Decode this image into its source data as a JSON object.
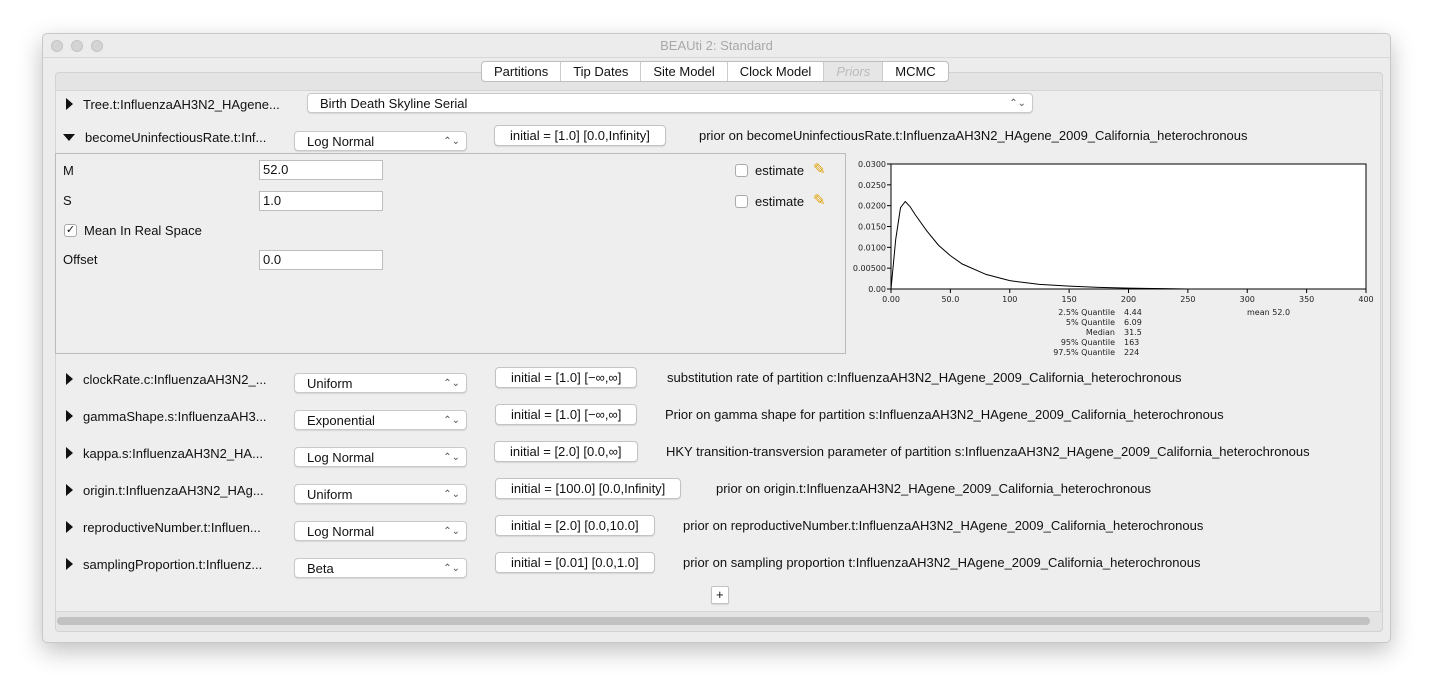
{
  "window": {
    "title": "BEAUti 2: Standard"
  },
  "tabs": [
    {
      "label": "Partitions"
    },
    {
      "label": "Tip Dates"
    },
    {
      "label": "Site Model"
    },
    {
      "label": "Clock Model"
    },
    {
      "label": "Priors",
      "disabled": true
    },
    {
      "label": "MCMC"
    }
  ],
  "tree": {
    "label": "Tree.t:InfluenzaAH3N2_HAgene...",
    "prior": "Birth Death Skyline Serial"
  },
  "expanded": {
    "label": "becomeUninfectiousRate.t:Inf...",
    "dist": "Log Normal",
    "initial": "initial = [1.0] [0.0,Infinity]",
    "desc": "prior on becomeUninfectiousRate.t:InfluenzaAH3N2_HAgene_2009_California_heterochronous",
    "params": {
      "m_label": "M",
      "m_value": "52.0",
      "s_label": "S",
      "s_value": "1.0",
      "mean_real_label": "Mean In Real Space",
      "mean_real_checked": true,
      "offset_label": "Offset",
      "offset_value": "0.0",
      "estimate_label": "estimate"
    }
  },
  "priors": [
    {
      "label": "clockRate.c:InfluenzaAH3N2_...",
      "dist": "Uniform",
      "initial": "initial = [1.0] [−∞,∞]",
      "desc": "substitution rate of partition c:InfluenzaAH3N2_HAgene_2009_California_heterochronous"
    },
    {
      "label": "gammaShape.s:InfluenzaAH3...",
      "dist": "Exponential",
      "initial": "initial = [1.0] [−∞,∞]",
      "desc": "Prior on gamma shape for partition s:InfluenzaAH3N2_HAgene_2009_California_heterochronous"
    },
    {
      "label": "kappa.s:InfluenzaAH3N2_HA...",
      "dist": "Log Normal",
      "initial": "initial = [2.0] [0.0,∞]",
      "desc": "HKY transition-transversion parameter of partition s:InfluenzaAH3N2_HAgene_2009_California_heterochronous"
    },
    {
      "label": "origin.t:InfluenzaAH3N2_HAg...",
      "dist": "Uniform",
      "initial": "initial = [100.0] [0.0,Infinity]",
      "desc": "prior on origin.t:InfluenzaAH3N2_HAgene_2009_California_heterochronous"
    },
    {
      "label": "reproductiveNumber.t:Influen...",
      "dist": "Log Normal",
      "initial": "initial = [2.0] [0.0,10.0]",
      "desc": "prior on reproductiveNumber.t:InfluenzaAH3N2_HAgene_2009_California_heterochronous"
    },
    {
      "label": "samplingProportion.t:Influenz...",
      "dist": "Beta",
      "initial": "initial = [0.01] [0.0,1.0]",
      "desc": "prior on sampling proportion t:InfluenzaAH3N2_HAgene_2009_California_heterochronous"
    }
  ],
  "add_label": "+",
  "chart_data": {
    "type": "line",
    "xlim": [
      0,
      400
    ],
    "ylim": [
      0,
      0.03
    ],
    "xticks": [
      "0.00",
      "50.0",
      "100",
      "150",
      "200",
      "250",
      "300",
      "350",
      "400"
    ],
    "yticks": [
      "0.00",
      "0.00500",
      "0.0100",
      "0.0150",
      "0.0200",
      "0.0250",
      "0.0300"
    ],
    "x": [
      0,
      4,
      8,
      12,
      16,
      20,
      30,
      40,
      50,
      60,
      80,
      100,
      125,
      150,
      175,
      200,
      230,
      250,
      400
    ],
    "y": [
      0,
      0.012,
      0.0195,
      0.021,
      0.0198,
      0.018,
      0.014,
      0.0105,
      0.008,
      0.006,
      0.0035,
      0.002,
      0.0011,
      0.0007,
      0.0004,
      0.0002,
      0.0001,
      0,
      0
    ],
    "stats": [
      {
        "label": "2.5% Quantile",
        "value": "4.44"
      },
      {
        "label": "5% Quantile",
        "value": "6.09"
      },
      {
        "label": "Median",
        "value": "31.5"
      },
      {
        "label": "95% Quantile",
        "value": "163"
      },
      {
        "label": "97.5% Quantile",
        "value": "224"
      }
    ],
    "mean": "mean 52.0"
  }
}
